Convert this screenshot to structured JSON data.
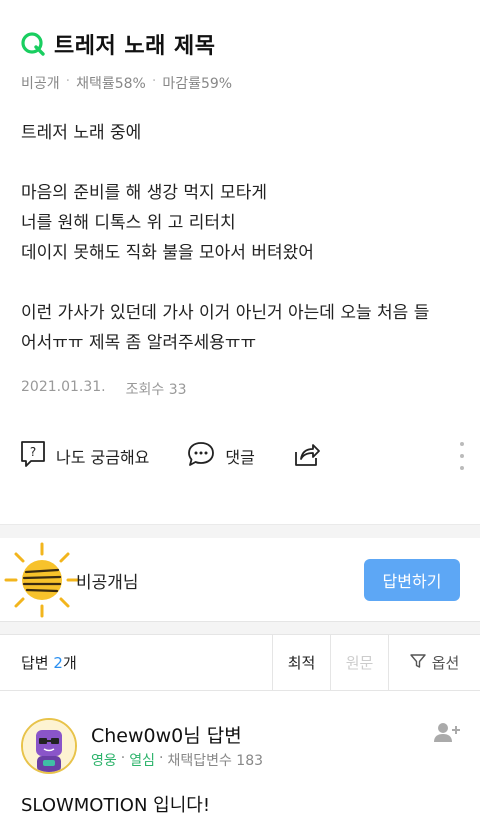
{
  "question": {
    "title": "트레저 노래 제목",
    "meta": {
      "visibility": "비공개",
      "adopt_rate": "채택률58%",
      "close_rate": "마감률59%"
    },
    "body_lines": [
      "트레저 노래 중에",
      "",
      "마음의 준비를 해 생강 먹지 모타게",
      "너를 원해 디톡스 위 고 리터치",
      "데이지 못해도 직화 불을 모아서 버텨왔어",
      "",
      "이런 가사가 있던데 가사 이거 아닌거 아는데 오늘 처음 들",
      "어서ㅠㅠ 제목 좀 알려주세용ㅠㅠ"
    ],
    "date": "2021.01.31.",
    "views": "조회수 33"
  },
  "actions": {
    "curious": "나도 궁금해요",
    "comment": "댓글",
    "share_icon": "share-icon",
    "more_icon": "more-vertical-icon"
  },
  "asker": {
    "name": "비공개님",
    "answer_button": "답변하기"
  },
  "answers_bar": {
    "label": "답변",
    "count": "2",
    "unit": "개",
    "sort_best": "최적",
    "sort_original": "원문",
    "options": "옵션"
  },
  "answer": {
    "author": "Chew0w0님 답변",
    "grade": "영웅",
    "badge": "열심",
    "adopted": "채택답변수 183",
    "text": "SLOWMOTION 입니다!"
  },
  "colors": {
    "brand_green": "#19ce60",
    "accent_blue": "#5da7f5",
    "count_blue": "#2a8ff0",
    "grade_green": "#2db36b"
  }
}
